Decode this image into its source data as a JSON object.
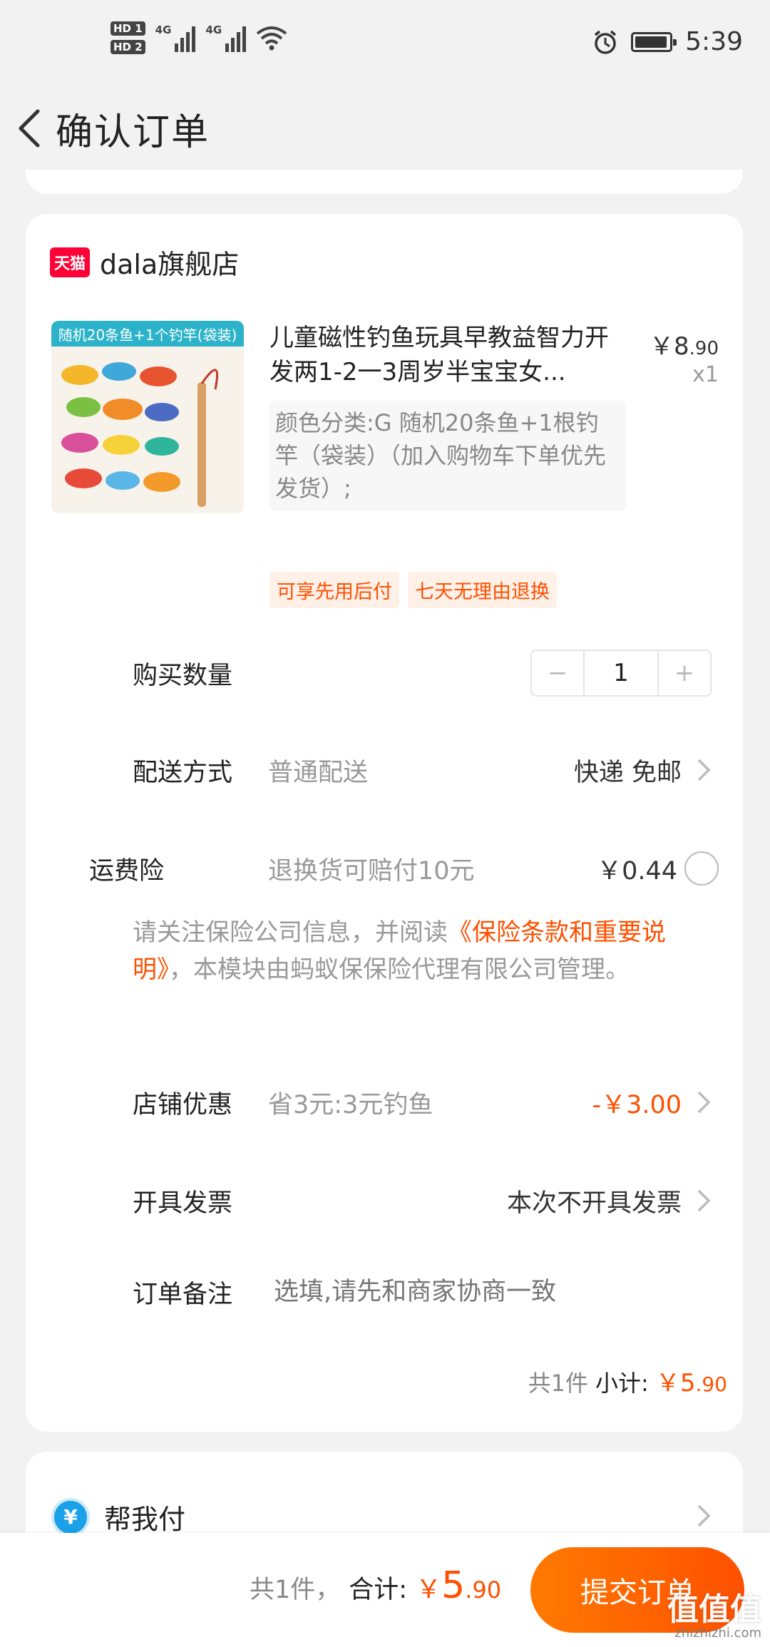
{
  "status_bar": {
    "sim1": "HD 1",
    "sim2": "HD 2",
    "network1": "4G",
    "network2": "4G",
    "time": "5:39"
  },
  "header": {
    "title": "确认订单"
  },
  "shop": {
    "badge": "天猫",
    "name": "dala旗舰店"
  },
  "product": {
    "banner": "随机20条鱼+1个钓竿(袋装)",
    "title": "儿童磁性钓鱼玩具早教益智力开发两1-2一3周岁半宝宝女...",
    "price_symbol": "￥",
    "price_int": "8",
    "price_dec": ".90",
    "quantity": "x1",
    "spec": "颜色分类:G 随机20条鱼+1根钓竿（袋装）（加入购物车下单优先发货）;",
    "tags": [
      "可享先用后付",
      "七天无理由退换"
    ]
  },
  "purchase_qty": {
    "label": "购买数量",
    "minus": "−",
    "value": "1",
    "plus": "+"
  },
  "delivery": {
    "label": "配送方式",
    "method": "普通配送",
    "value": "快递 免邮"
  },
  "shipping_insurance": {
    "label": "运费险",
    "desc": "退换货可赔付10元",
    "price": "￥0.44"
  },
  "insurance_notice": {
    "prefix": "请关注保险公司信息，并阅读",
    "link": "《保险条款和重要说明》",
    "suffix": "，本模块由蚂蚁保保险代理有限公司管理。"
  },
  "shop_discount": {
    "label": "店铺优惠",
    "desc": "省3元:3元钓鱼",
    "value": "-￥3.00"
  },
  "invoice": {
    "label": "开具发票",
    "value": "本次不开具发票"
  },
  "remark": {
    "label": "订单备注",
    "placeholder": "选填,请先和商家协商一致"
  },
  "subtotal": {
    "count": "共1件",
    "label": "小计:",
    "symbol": "￥",
    "int": "5",
    "dec": ".90"
  },
  "pay_for_me": {
    "icon": "¥",
    "label": "帮我付"
  },
  "bottom": {
    "count": "共1件，",
    "label": "合计:",
    "symbol": "￥",
    "int": "5",
    "dec": ".90",
    "submit": "提交订单"
  },
  "watermark": {
    "text": "值值值",
    "url": "zhizhizhi.com"
  },
  "colors": {
    "accent": "#ff5000",
    "tmall": "#ff0036",
    "pay_blue": "#1aa1e8",
    "background": "#f2f2f2"
  }
}
